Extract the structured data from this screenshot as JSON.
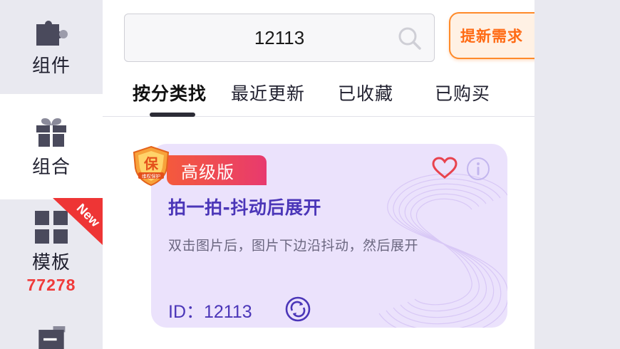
{
  "sidebar": {
    "items": [
      {
        "label": "组件",
        "icon": "puzzle-icon"
      },
      {
        "label": "组合",
        "icon": "gift-icon",
        "active": true
      },
      {
        "label": "模板",
        "icon": "grid-icon",
        "count": "77278",
        "ribbon": "New"
      },
      {
        "label": "",
        "icon": "folder-icon"
      }
    ]
  },
  "search": {
    "value": "12113",
    "icon": "search-icon"
  },
  "request_button": {
    "label": "提新需求"
  },
  "tabs": [
    {
      "label": "按分类找",
      "active": true
    },
    {
      "label": "最近更新"
    },
    {
      "label": "已收藏"
    },
    {
      "label": "已购买"
    }
  ],
  "card": {
    "badge": "高级版",
    "shield_text": "保",
    "shield_sub": "维权保护",
    "title": "拍一拍-抖动后展开",
    "description": "双击图片后，图片下边沿抖动，然后展开",
    "id_text": "ID：12113",
    "colors": {
      "background": "#ebe2fc",
      "title": "#4b36b8",
      "badge": "#e8456a",
      "heart": "#e8434e"
    }
  }
}
